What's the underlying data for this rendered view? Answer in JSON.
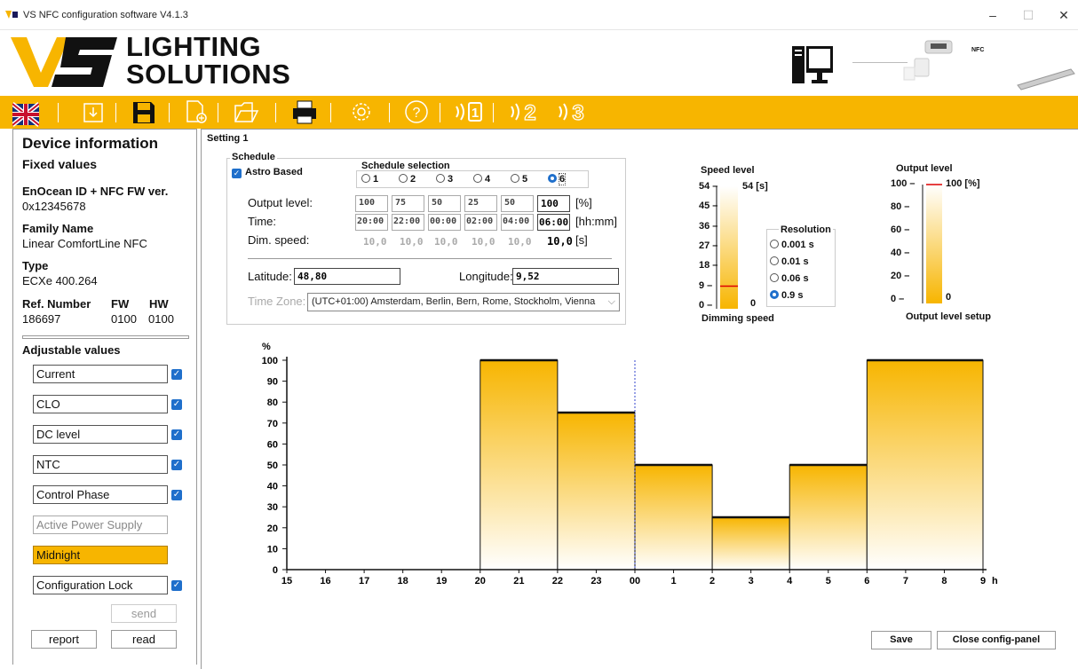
{
  "window": {
    "title": "VS NFC configuration software V4.1.3"
  },
  "brand": {
    "line1": "LIGHTING",
    "line2": "SOLUTIONS",
    "nfc_label": "NFC"
  },
  "toolbar": {
    "language": "uk-flag-icon"
  },
  "left": {
    "heading": "Device information",
    "fixed_heading": "Fixed values",
    "enocean_label": "EnOcean ID + NFC FW ver.",
    "enocean_value": "0x12345678",
    "family_label": "Family Name",
    "family_value": "Linear ComfortLine NFC",
    "type_label": "Type",
    "type_value": "ECXe 400.264",
    "ref_label": "Ref. Number",
    "ref_value": "186697",
    "fw_label": "FW",
    "fw_value": "0100",
    "hw_label": "HW",
    "hw_value": "0100",
    "adjustable_heading": "Adjustable values",
    "adjustable": [
      "Current",
      "CLO",
      "DC level",
      "NTC",
      "Control Phase",
      "Active Power Supply",
      "Midnight",
      "Configuration Lock"
    ],
    "send_label": "send",
    "report_label": "report",
    "read_label": "read"
  },
  "main": {
    "setting_title": "Setting 1",
    "schedule_title": "Schedule",
    "astro_label": "Astro Based",
    "selection_title": "Schedule selection",
    "selection_options": [
      "1",
      "2",
      "3",
      "4",
      "5",
      "6"
    ],
    "selected_option": "6",
    "output_label": "Output level:",
    "output_values": [
      "100",
      "75",
      "50",
      "25",
      "50",
      "100"
    ],
    "output_unit": "[%]",
    "time_label": "Time:",
    "time_values": [
      "20:00",
      "22:00",
      "00:00",
      "02:00",
      "04:00",
      "06:00"
    ],
    "time_unit": "[hh:mm]",
    "speed_label": "Dim. speed:",
    "speed_values": [
      "10,0",
      "10,0",
      "10,0",
      "10,0",
      "10,0",
      "10,0"
    ],
    "speed_unit": "[s]",
    "latitude_label": "Latitude:",
    "latitude_value": "48,80",
    "longitude_label": "Longitude:",
    "longitude_value": "9,52",
    "timezone_label": "Time Zone:",
    "timezone_value": "(UTC+01:00) Amsterdam, Berlin, Bern, Rome, Stockholm, Vienna",
    "save_label": "Save",
    "close_label": "Close config-panel"
  },
  "speed_gauge": {
    "title": "Speed level",
    "value_label": "54 [s]",
    "ticks": [
      "54",
      "45",
      "36",
      "27",
      "18",
      "9",
      "0"
    ],
    "bottom_value": "0",
    "footer": "Dimming speed",
    "level_fraction": 0.185
  },
  "resolution": {
    "title": "Resolution",
    "options": [
      "0.001 s",
      "0.01 s",
      "0.06 s",
      "0.9 s"
    ],
    "selected": "0.9 s"
  },
  "output_gauge": {
    "title": "Output level",
    "value_label": "100 [%]",
    "ticks": [
      "100",
      "80",
      "60",
      "40",
      "20",
      "0"
    ],
    "bottom_value": "0",
    "footer": "Output level setup",
    "level_fraction": 1.0
  },
  "chart_data": {
    "type": "area",
    "ylabel": "%",
    "xlabel": "h",
    "x_ticks": [
      "15",
      "16",
      "17",
      "18",
      "19",
      "20",
      "21",
      "22",
      "23",
      "00",
      "1",
      "2",
      "3",
      "4",
      "5",
      "6",
      "7",
      "8",
      "9"
    ],
    "y_ticks": [
      "100",
      "90",
      "80",
      "70",
      "60",
      "50",
      "40",
      "30",
      "20",
      "10",
      "0"
    ],
    "ylim": [
      0,
      100
    ],
    "xlim_hours_from_15": [
      0,
      18
    ],
    "steps": [
      {
        "from": "20:00",
        "to": "22:00",
        "value": 100
      },
      {
        "from": "22:00",
        "to": "00:00",
        "value": 75
      },
      {
        "from": "00:00",
        "to": "02:00",
        "value": 50
      },
      {
        "from": "02:00",
        "to": "04:00",
        "value": 25
      },
      {
        "from": "04:00",
        "to": "06:00",
        "value": 50
      },
      {
        "from": "06:00",
        "to": "09:00",
        "value": 100
      }
    ],
    "midnight_marker": "00"
  },
  "colors": {
    "accent": "#f7b500",
    "check": "#1f6fcb",
    "highlight": "#f7b500"
  }
}
